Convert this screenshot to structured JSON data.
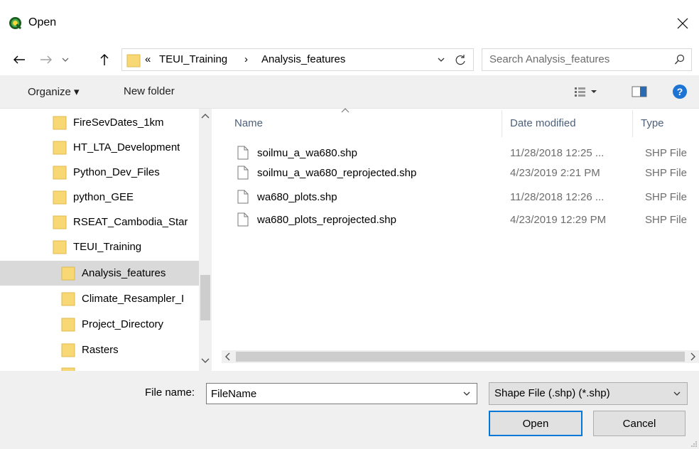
{
  "window": {
    "title": "Open"
  },
  "address": {
    "overflow": "«",
    "crumbs": [
      "TEUI_Training",
      "Analysis_features"
    ],
    "separator": "›"
  },
  "search": {
    "placeholder": "Search Analysis_features"
  },
  "toolbar": {
    "organize_label": "Organize ▾",
    "new_folder_label": "New folder"
  },
  "nav": {
    "items": [
      {
        "label": "FireSevDates_1km"
      },
      {
        "label": "HT_LTA_Development"
      },
      {
        "label": "Python_Dev_Files"
      },
      {
        "label": "python_GEE"
      },
      {
        "label": "RSEAT_Cambodia_Star"
      },
      {
        "label": "TEUI_Training"
      },
      {
        "label": "Analysis_features"
      },
      {
        "label": "Climate_Resampler_I"
      },
      {
        "label": "Project_Directory"
      },
      {
        "label": "Rasters"
      }
    ]
  },
  "columns": {
    "name": "Name",
    "date": "Date modified",
    "type": "Type"
  },
  "files": [
    {
      "name": "soilmu_a_wa680.shp",
      "date": "11/28/2018 12:25 ...",
      "type": "SHP File"
    },
    {
      "name": "soilmu_a_wa680_reprojected.shp",
      "date": "4/23/2019 2:21 PM",
      "type": "SHP File"
    },
    {
      "name": "wa680_plots.shp",
      "date": "11/28/2018 12:26 ...",
      "type": "SHP File"
    },
    {
      "name": "wa680_plots_reprojected.shp",
      "date": "4/23/2019 12:29 PM",
      "type": "SHP File"
    }
  ],
  "bottom": {
    "file_name_label": "File name:",
    "file_name_value": "FileName",
    "file_type": "Shape File (.shp) (*.shp)",
    "open_label": "Open",
    "cancel_label": "Cancel"
  },
  "colors": {
    "accent": "#0078d7",
    "help": "#1e74d3",
    "folder": "#f8d775",
    "selected": "#d9d9d9"
  },
  "icons": [
    "qgis-icon",
    "close-icon",
    "back-arrow-icon",
    "forward-arrow-icon",
    "recent-chevron-icon",
    "up-arrow-icon",
    "folder-icon",
    "refresh-icon",
    "search-icon",
    "view-options-icon",
    "preview-pane-icon",
    "help-icon",
    "file-icon",
    "grip-icon"
  ]
}
